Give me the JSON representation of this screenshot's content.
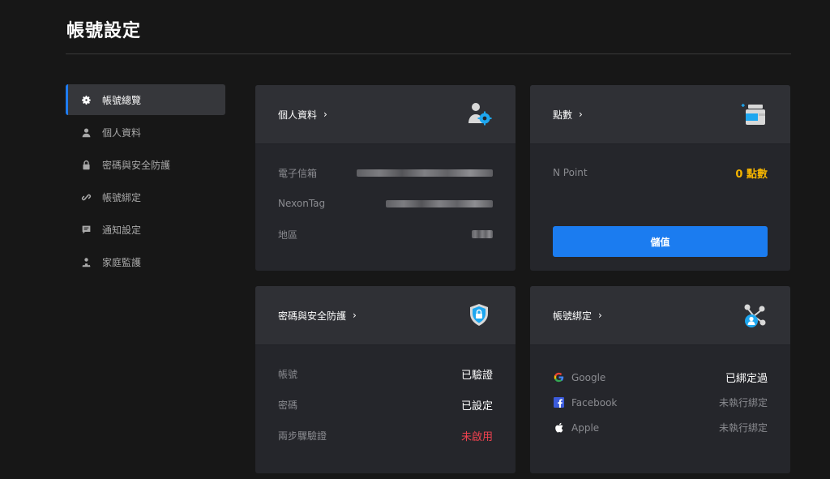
{
  "page": {
    "title": "帳號設定"
  },
  "sidebar": {
    "items": [
      {
        "label": "帳號總覽",
        "icon": "gear-icon"
      },
      {
        "label": "個人資料",
        "icon": "person-icon"
      },
      {
        "label": "密碼與安全防護",
        "icon": "lock-icon"
      },
      {
        "label": "帳號綁定",
        "icon": "link-icon"
      },
      {
        "label": "通知設定",
        "icon": "message-icon"
      },
      {
        "label": "家庭監護",
        "icon": "family-icon"
      }
    ]
  },
  "profile": {
    "title": "個人資料",
    "email_label": "電子信箱",
    "nexontag_label": "NexonTag",
    "region_label": "地區"
  },
  "points": {
    "title": "點數",
    "npoint_label": "N Point",
    "npoint_value": "0 點數",
    "charge_label": "儲值"
  },
  "security": {
    "title": "密碼與安全防護",
    "rows": [
      {
        "label": "帳號",
        "value": "已驗證"
      },
      {
        "label": "密碼",
        "value": "已設定"
      },
      {
        "label": "兩步驟驗證",
        "value": "未啟用"
      }
    ]
  },
  "binding": {
    "title": "帳號綁定",
    "rows": [
      {
        "name": "Google",
        "status": "已綁定過"
      },
      {
        "name": "Facebook",
        "status": "未執行綁定"
      },
      {
        "name": "Apple",
        "status": "未執行綁定"
      }
    ]
  },
  "colors": {
    "accent": "#1b7cf0",
    "gold": "#f4b400",
    "danger": "#f0424f"
  }
}
